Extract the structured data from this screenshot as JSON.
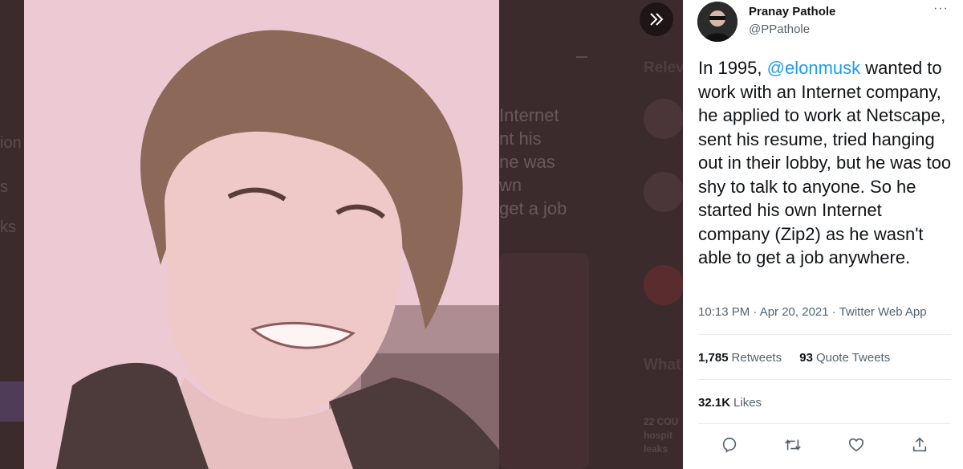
{
  "background": {
    "left_fragments": [
      "ion",
      "s",
      "ks"
    ],
    "middle_lines": [
      "Internet",
      "nt his",
      "ne was",
      "wn",
      "get a job"
    ],
    "sidebar_title_1": "Relev",
    "sidebar_title_2": "What",
    "trend_lines": [
      "22 COU",
      "hospit",
      "leaks"
    ]
  },
  "tweet": {
    "author_name": "Pranay Pathole",
    "author_handle": "@PPathole",
    "more_label": "···",
    "body_before_mention": "In 1995, ",
    "mention": "@elonmusk",
    "body_after_mention": " wanted to work with an Internet company, he applied to work at Netscape, sent his resume, tried hanging out in their lobby, but he was too shy to talk to anyone. So he started his own Internet company (Zip2) as he wasn't able to get a job anywhere.",
    "timestamp": "10:13 PM · Apr 20, 2021 · ",
    "source_app": "Twitter Web App",
    "retweets_count": "1,785",
    "retweets_label": "Retweets",
    "quote_count": "93",
    "quote_label": "Quote Tweets",
    "likes_count": "32.1K",
    "likes_label": "Likes"
  },
  "icons": {
    "expand": "double-chevron-right-icon",
    "reply": "reply-icon",
    "retweet": "retweet-icon",
    "like": "heart-icon",
    "share": "share-icon"
  },
  "colors": {
    "accent": "#1d9bf0",
    "text_primary": "#0f1419",
    "text_secondary": "#536471"
  }
}
